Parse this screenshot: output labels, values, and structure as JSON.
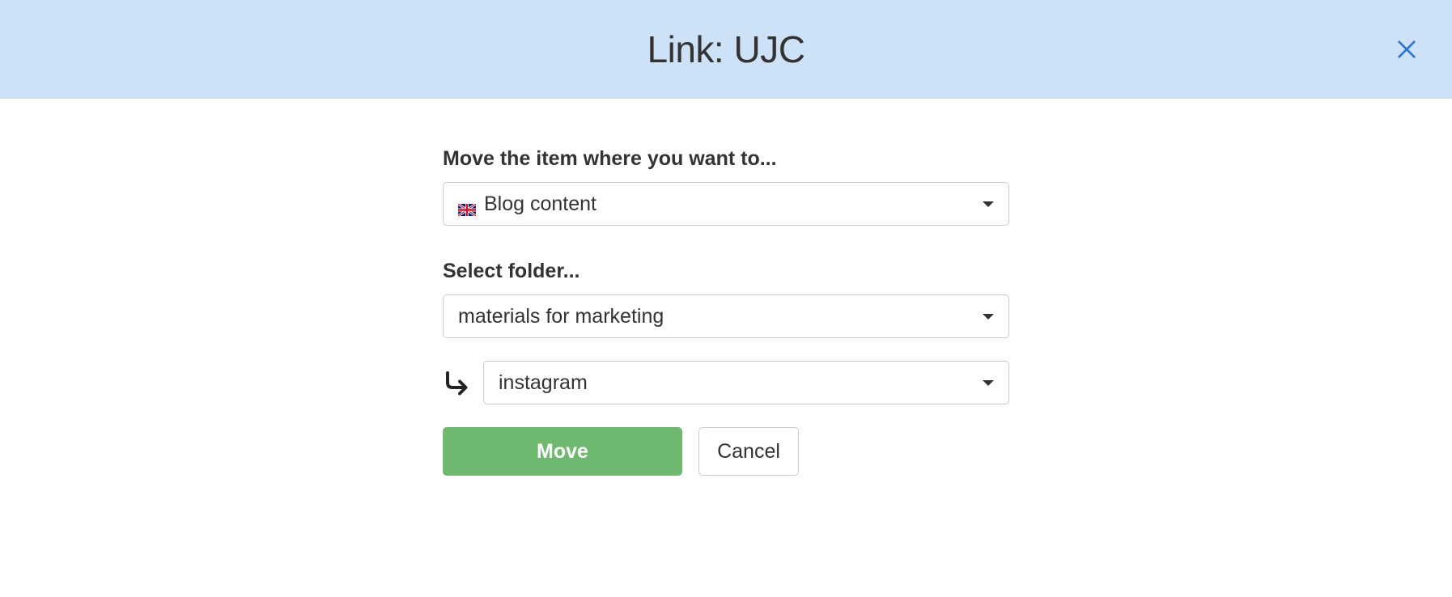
{
  "header": {
    "title": "Link: UJC"
  },
  "form": {
    "location_label": "Move the item where you want to...",
    "location_value": "Blog content",
    "folder_label": "Select folder...",
    "folder_value": "materials for marketing",
    "subfolder_value": "instagram"
  },
  "buttons": {
    "move_label": "Move",
    "cancel_label": "Cancel"
  }
}
